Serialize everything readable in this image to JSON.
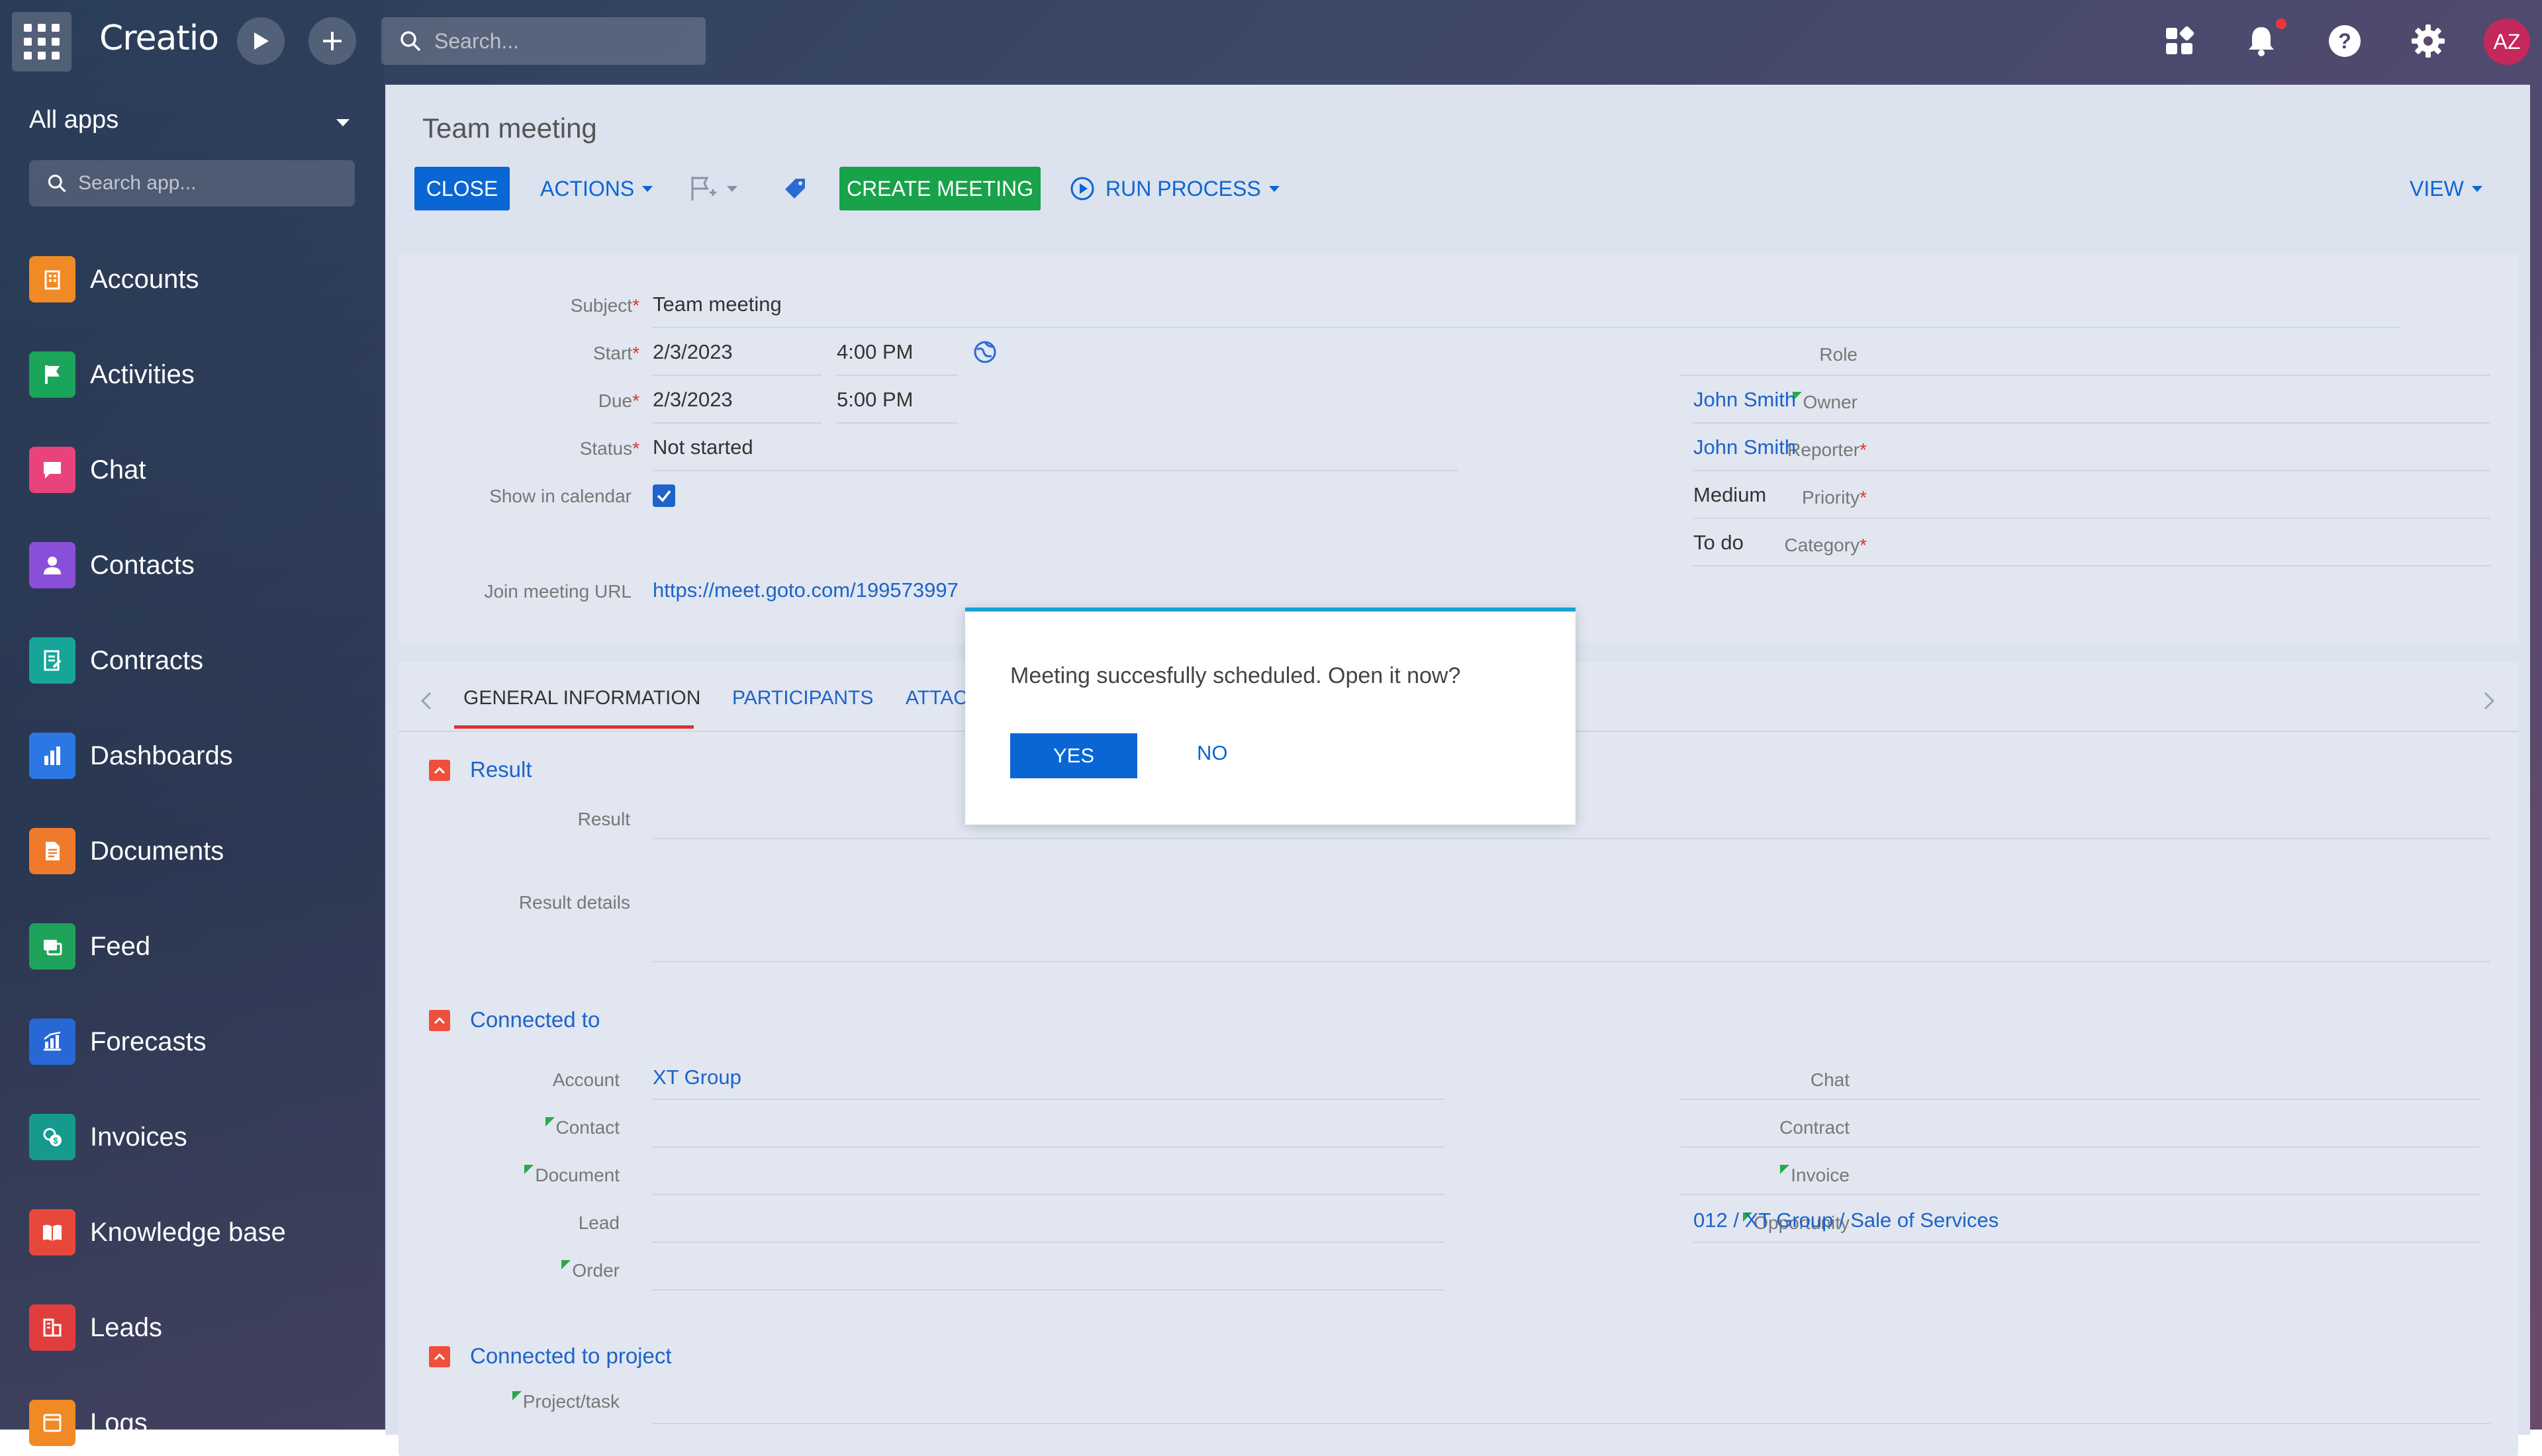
{
  "topbar": {
    "logo": "Creatio",
    "search_placeholder": "Search...",
    "avatar_initials": "AZ"
  },
  "sidebar": {
    "header": "All apps",
    "search_placeholder": "Search app...",
    "items": [
      {
        "label": "Accounts",
        "color": "#f08a24",
        "icon": "building-icon"
      },
      {
        "label": "Activities",
        "color": "#1aa55a",
        "icon": "flag-icon"
      },
      {
        "label": "Chat",
        "color": "#e8437a",
        "icon": "chat-bubble-icon"
      },
      {
        "label": "Contacts",
        "color": "#8a4fd8",
        "icon": "person-icon"
      },
      {
        "label": "Contracts",
        "color": "#17a59a",
        "icon": "contract-icon"
      },
      {
        "label": "Dashboards",
        "color": "#2b78e4",
        "icon": "bar-chart-icon"
      },
      {
        "label": "Documents",
        "color": "#f07a2c",
        "icon": "document-icon"
      },
      {
        "label": "Feed",
        "color": "#1fa35a",
        "icon": "feed-icon"
      },
      {
        "label": "Forecasts",
        "color": "#2768d6",
        "icon": "forecast-icon"
      },
      {
        "label": "Invoices",
        "color": "#169a8e",
        "icon": "invoice-icon"
      },
      {
        "label": "Knowledge base",
        "color": "#e8483c",
        "icon": "book-icon"
      },
      {
        "label": "Leads",
        "color": "#e23d3d",
        "icon": "leads-icon"
      },
      {
        "label": "Logs",
        "color": "#f08a24",
        "icon": "logs-icon"
      }
    ]
  },
  "page": {
    "title": "Team meeting",
    "toolbar": {
      "close": "CLOSE",
      "actions": "ACTIONS",
      "create_meeting": "CREATE MEETING",
      "run_process": "RUN PROCESS",
      "view": "VIEW"
    },
    "fields": {
      "subject_label": "Subject",
      "subject_value": "Team meeting",
      "start_label": "Start",
      "start_date": "2/3/2023",
      "start_time": "4:00 PM",
      "due_label": "Due",
      "due_date": "2/3/2023",
      "due_time": "5:00 PM",
      "status_label": "Status",
      "status_value": "Not started",
      "show_calendar_label": "Show in calendar",
      "join_url_label": "Join meeting URL",
      "join_url_value": "https://meet.goto.com/199573997",
      "role_label": "Role",
      "owner_label": "Owner",
      "owner_value": "John Smith",
      "reporter_label": "Reporter",
      "reporter_value": "John Smith",
      "priority_label": "Priority",
      "priority_value": "Medium",
      "category_label": "Category",
      "category_value": "To do"
    },
    "tabs": [
      "GENERAL INFORMATION",
      "PARTICIPANTS",
      "ATTACH"
    ],
    "sections": {
      "result": {
        "title": "Result",
        "result_label": "Result",
        "details_label": "Result details"
      },
      "connected": {
        "title": "Connected to",
        "account_label": "Account",
        "account_value": "XT Group",
        "contact_label": "Contact",
        "document_label": "Document",
        "lead_label": "Lead",
        "order_label": "Order",
        "chat_label": "Chat",
        "contract_label": "Contract",
        "invoice_label": "Invoice",
        "opportunity_label": "Opportunity",
        "opportunity_value": "012 / XT Group / Sale of Services"
      },
      "project": {
        "title": "Connected to project",
        "project_label": "Project/task"
      }
    }
  },
  "dialog": {
    "message": "Meeting succesfully scheduled. Open it now?",
    "yes": "YES",
    "no": "NO"
  }
}
